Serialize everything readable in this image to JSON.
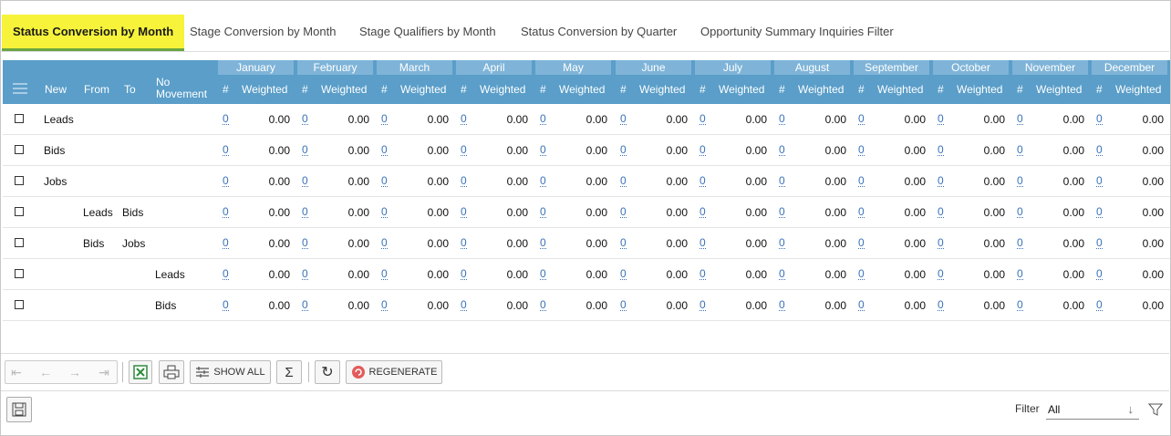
{
  "tabs": [
    {
      "label": "Status Conversion by Month",
      "active": true
    },
    {
      "label": "Stage Conversion by Month",
      "active": false
    },
    {
      "label": "Stage Qualifiers by Month",
      "active": false
    },
    {
      "label": "Status Conversion by Quarter",
      "active": false
    },
    {
      "label": "Opportunity Summary Inquiries Filter",
      "active": false
    }
  ],
  "grid": {
    "header_bg": "#5a9ec9",
    "columns": {
      "new": "New",
      "from": "From",
      "to": "To",
      "no_movement": "No Movement",
      "count": "#",
      "weighted": "Weighted"
    },
    "months": [
      "January",
      "February",
      "March",
      "April",
      "May",
      "June",
      "July",
      "August",
      "September",
      "October",
      "November",
      "December"
    ],
    "rows": [
      {
        "new": "Leads",
        "from": "",
        "to": "",
        "no_movement": "",
        "count": "0",
        "weighted": "0.00"
      },
      {
        "new": "Bids",
        "from": "",
        "to": "",
        "no_movement": "",
        "count": "0",
        "weighted": "0.00"
      },
      {
        "new": "Jobs",
        "from": "",
        "to": "",
        "no_movement": "",
        "count": "0",
        "weighted": "0.00"
      },
      {
        "new": "",
        "from": "Leads",
        "to": "Bids",
        "no_movement": "",
        "count": "0",
        "weighted": "0.00"
      },
      {
        "new": "",
        "from": "Bids",
        "to": "Jobs",
        "no_movement": "",
        "count": "0",
        "weighted": "0.00"
      },
      {
        "new": "",
        "from": "",
        "to": "",
        "no_movement": "Leads",
        "count": "0",
        "weighted": "0.00"
      },
      {
        "new": "",
        "from": "",
        "to": "",
        "no_movement": "Bids",
        "count": "0",
        "weighted": "0.00"
      }
    ]
  },
  "toolbar": {
    "show_all_label": "SHOW ALL",
    "regenerate_label": "REGENERATE",
    "icons": [
      "first-page-icon",
      "previous-page-icon",
      "next-page-icon",
      "last-page-icon",
      "excel-export-icon",
      "print-icon",
      "show-all-icon",
      "sum-icon",
      "refresh-icon",
      "regenerate-icon"
    ]
  },
  "bottom": {
    "filter_label": "Filter",
    "filter_value": "All"
  }
}
